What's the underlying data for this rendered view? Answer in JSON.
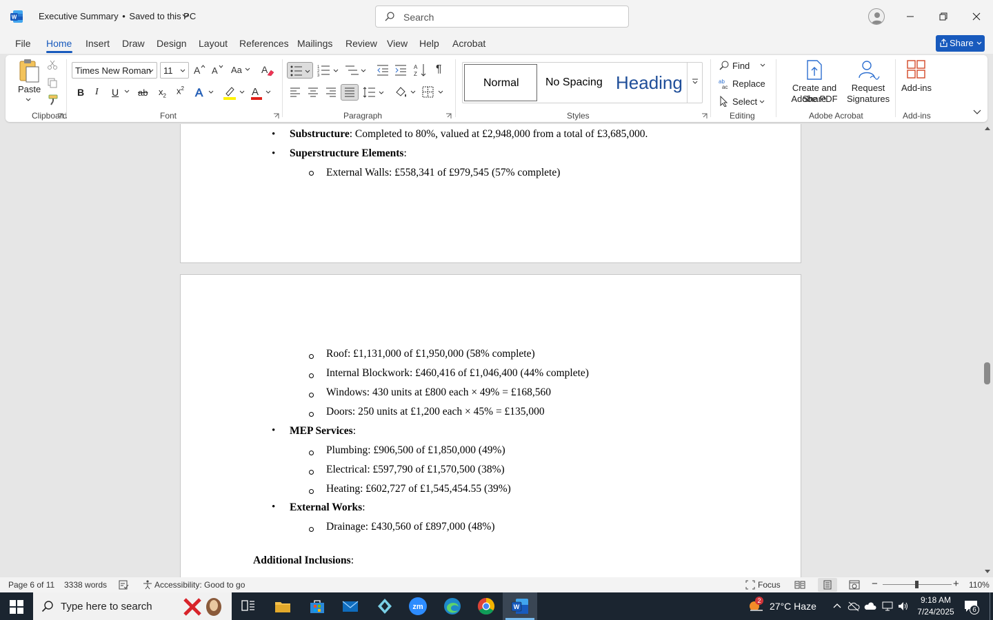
{
  "titlebar": {
    "doc_name": "Executive Summary",
    "separator": "•",
    "save_status": "Saved to this PC",
    "search_placeholder": "Search"
  },
  "tabs": [
    "File",
    "Home",
    "Insert",
    "Draw",
    "Design",
    "Layout",
    "References",
    "Mailings",
    "Review",
    "View",
    "Help",
    "Acrobat"
  ],
  "share_label": "Share",
  "ribbon": {
    "clipboard": {
      "paste": "Paste",
      "label": "Clipboard"
    },
    "font": {
      "name": "Times New Roman",
      "size": "11",
      "label": "Font"
    },
    "paragraph": {
      "label": "Paragraph"
    },
    "styles": {
      "normal": "Normal",
      "no_spacing": "No Spacing",
      "heading": "Heading",
      "label": "Styles"
    },
    "editing": {
      "find": "Find",
      "replace": "Replace",
      "select": "Select",
      "label": "Editing"
    },
    "acrobat": {
      "create_share_line1": "Create and Share",
      "create_share_line2": "Adobe PDF",
      "request_line1": "Request",
      "request_line2": "Signatures",
      "label": "Adobe Acrobat"
    },
    "addins": {
      "button": "Add-ins",
      "label": "Add-ins"
    }
  },
  "document": {
    "page1": {
      "b1_bold": "Substructure",
      "b1_rest": ": Completed to 80%, valued at £2,948,000 from a total of £3,685,000.",
      "b2_bold": "Superstructure Elements",
      "b2_rest": ":",
      "s1": "External Walls: £558,341 of £979,545 (57% complete)"
    },
    "page2": {
      "s_roof": "Roof: £1,131,000 of £1,950,000 (58% complete)",
      "s_block": "Internal Blockwork: £460,416 of £1,046,400 (44% complete)",
      "s_windows": "Windows: 430 units at £800 each × 49% = £168,560",
      "s_doors": "Doors: 250 units at £1,200 each × 45% = £135,000",
      "mep_bold": "MEP Services",
      "mep_rest": ":",
      "s_plumbing": "Plumbing: £906,500 of £1,850,000 (49%)",
      "s_electrical": "Electrical: £597,790 of £1,570,500 (38%)",
      "s_heating": "Heating: £602,727 of £1,545,454.55 (39%)",
      "ext_bold": "External Works",
      "ext_rest": ":",
      "s_drainage": "Drainage: £430,560 of £897,000 (48%)",
      "add_bold": "Additional Inclusions",
      "add_rest": ":"
    }
  },
  "statusbar": {
    "page": "Page 6 of 11",
    "words": "3338 words",
    "accessibility": "Accessibility: Good to go",
    "focus": "Focus",
    "zoom": "110%"
  },
  "taskbar": {
    "search_placeholder": "Type here to search",
    "weather": "27°C  Haze",
    "time": "9:18 AM",
    "date": "7/24/2025",
    "notif_badge": "2",
    "action_count": "6"
  }
}
